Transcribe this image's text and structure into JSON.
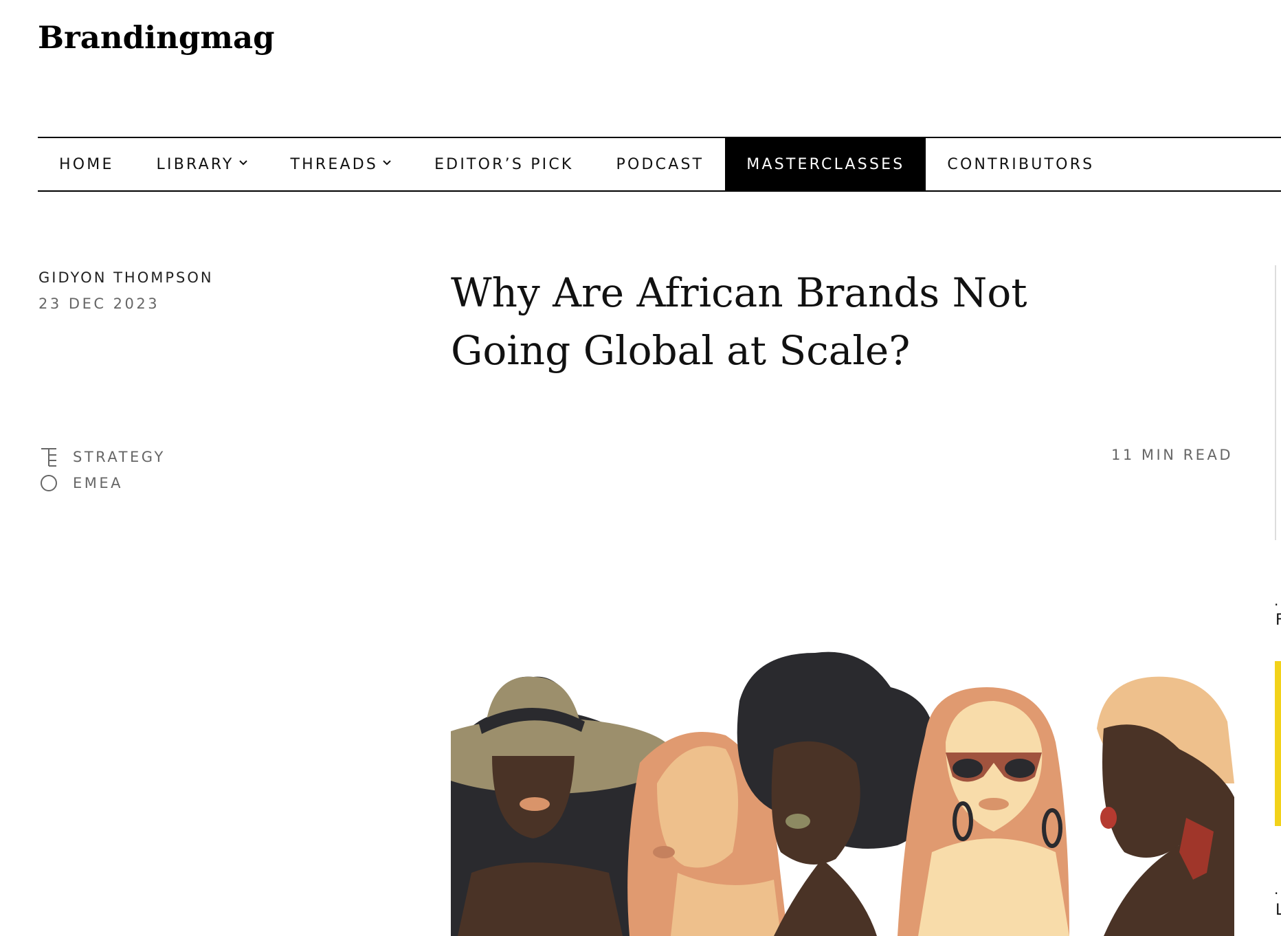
{
  "site": {
    "logo": "Brandingmag"
  },
  "nav": {
    "items": [
      {
        "label": "HOME",
        "dropdown": false,
        "active": false
      },
      {
        "label": "LIBRARY",
        "dropdown": true,
        "active": false
      },
      {
        "label": "THREADS",
        "dropdown": true,
        "active": false
      },
      {
        "label": "EDITOR’S PICK",
        "dropdown": false,
        "active": false
      },
      {
        "label": "PODCAST",
        "dropdown": false,
        "active": false
      },
      {
        "label": "MASTERCLASSES",
        "dropdown": false,
        "active": true
      },
      {
        "label": "CONTRIBUTORS",
        "dropdown": false,
        "active": false
      }
    ],
    "chevron": "⌄"
  },
  "article": {
    "author": "GIDYON THOMPSON",
    "date": "23 DEC 2023",
    "title": "Why Are African Brands Not Going Global at Scale?",
    "read_time": "11 MIN READ",
    "tags": [
      {
        "icon": "strategy-icon",
        "label": "STRATEGY"
      },
      {
        "icon": "region-globe-icon",
        "label": "EMEA"
      }
    ],
    "hero_image": "illustration of five diverse women"
  },
  "sidebar": {
    "text_1": ".",
    "text_2": "F",
    "text_3": ".",
    "text_4": "L"
  },
  "colors": {
    "accent": "#000000",
    "muted_text": "#666666",
    "ad_yellow": "#f2d21a"
  }
}
